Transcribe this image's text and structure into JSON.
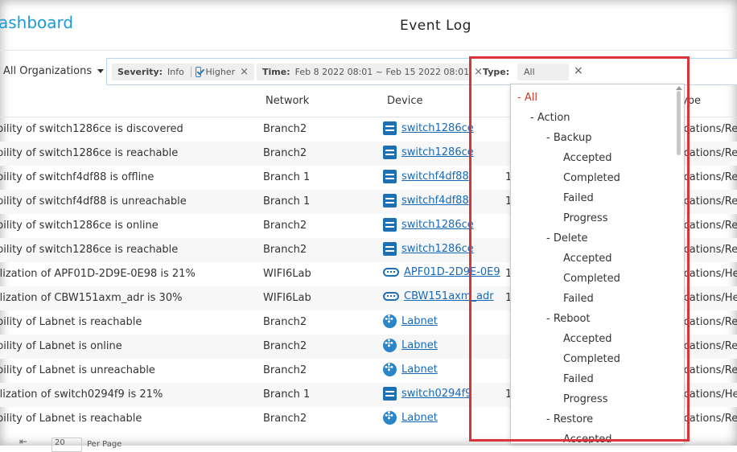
{
  "header": {
    "brand": "ashboard",
    "title": "Event Log"
  },
  "filters": {
    "organization": "All Organizations",
    "severity_key": "Severity:",
    "severity_value": "Info",
    "severity_option": "Higher",
    "time_key": "Time:",
    "time_value": "Feb 8 2022 08:01 ~ Feb 15 2022 08:01",
    "type_key": "Type:",
    "type_value": "All",
    "clear_glyph": "×"
  },
  "columns": {
    "network": "Network",
    "device": "Device",
    "type": "ype"
  },
  "rows": [
    {
      "message": "bility of switch1286ce is discovered",
      "network": "Branch2",
      "device": "switch1286ce",
      "icon": "switch-icon",
      "extra": "",
      "type": "ications/Re"
    },
    {
      "message": "bility of switch1286ce is reachable",
      "network": "Branch2",
      "device": "switch1286ce",
      "icon": "switch-icon",
      "extra": "",
      "type": "ications/Re"
    },
    {
      "message": "bility of switchf4df88 is offline",
      "network": "Branch 1",
      "device": "switchf4df88",
      "icon": "switch-icon",
      "extra": "1",
      "type": "ications/Re"
    },
    {
      "message": "bility of switchf4df88 is unreachable",
      "network": "Branch 1",
      "device": "switchf4df88",
      "icon": "switch-icon",
      "extra": "1",
      "type": "ications/Re"
    },
    {
      "message": "bility of switch1286ce is online",
      "network": "Branch2",
      "device": "switch1286ce",
      "icon": "switch-icon",
      "extra": "",
      "type": "ications/Re"
    },
    {
      "message": "bility of switch1286ce is reachable",
      "network": "Branch2",
      "device": "switch1286ce",
      "icon": "switch-icon",
      "extra": "",
      "type": "ications/Re"
    },
    {
      "message": "ilization of APF01D-2D9E-0E98 is 21%",
      "network": "WIFI6Lab",
      "device": "APF01D-2D9E-0E9",
      "icon": "access-point-icon",
      "extra": "1",
      "type": "ications/He"
    },
    {
      "message": "ilization of CBW151axm_adr is 30%",
      "network": "WIFI6Lab",
      "device": "CBW151axm_adr",
      "icon": "access-point-icon",
      "extra": "1",
      "type": "ications/He"
    },
    {
      "message": "bility of Labnet is reachable",
      "network": "Branch2",
      "device": "Labnet",
      "icon": "router-icon",
      "extra": "",
      "type": "ications/Re"
    },
    {
      "message": "bility of Labnet is online",
      "network": "Branch2",
      "device": "Labnet",
      "icon": "router-icon",
      "extra": "",
      "type": "ications/Re"
    },
    {
      "message": "bility of Labnet is unreachable",
      "network": "Branch2",
      "device": "Labnet",
      "icon": "router-icon",
      "extra": "",
      "type": "ications/Re"
    },
    {
      "message": "ilization of switch0294f9 is 21%",
      "network": "Branch 1",
      "device": "switch0294f9",
      "icon": "switch-icon",
      "extra": "1",
      "type": "ications/He"
    },
    {
      "message": "bility of Labnet is reachable",
      "network": "Branch2",
      "device": "Labnet",
      "icon": "router-icon",
      "extra": "",
      "type": "ications/Re"
    }
  ],
  "pagination": {
    "page_size": "20",
    "label": "Per Page"
  },
  "type_menu": [
    {
      "label": "- All",
      "depth": 0,
      "selected": true
    },
    {
      "label": "- Action",
      "depth": 1
    },
    {
      "label": "- Backup",
      "depth": 2
    },
    {
      "label": "Accepted",
      "depth": 3
    },
    {
      "label": "Completed",
      "depth": 3
    },
    {
      "label": "Failed",
      "depth": 3
    },
    {
      "label": "Progress",
      "depth": 3
    },
    {
      "label": "- Delete",
      "depth": 2
    },
    {
      "label": "Accepted",
      "depth": 3
    },
    {
      "label": "Completed",
      "depth": 3
    },
    {
      "label": "Failed",
      "depth": 3
    },
    {
      "label": "- Reboot",
      "depth": 2
    },
    {
      "label": "Accepted",
      "depth": 3
    },
    {
      "label": "Completed",
      "depth": 3
    },
    {
      "label": "Failed",
      "depth": 3
    },
    {
      "label": "Progress",
      "depth": 3
    },
    {
      "label": "- Restore",
      "depth": 2
    },
    {
      "label": "Accepted",
      "depth": 3
    }
  ],
  "colors": {
    "accent": "#1a9ad6",
    "link": "#1769b6",
    "selected": "#d0392b",
    "highlight_box": "#d9343a"
  }
}
